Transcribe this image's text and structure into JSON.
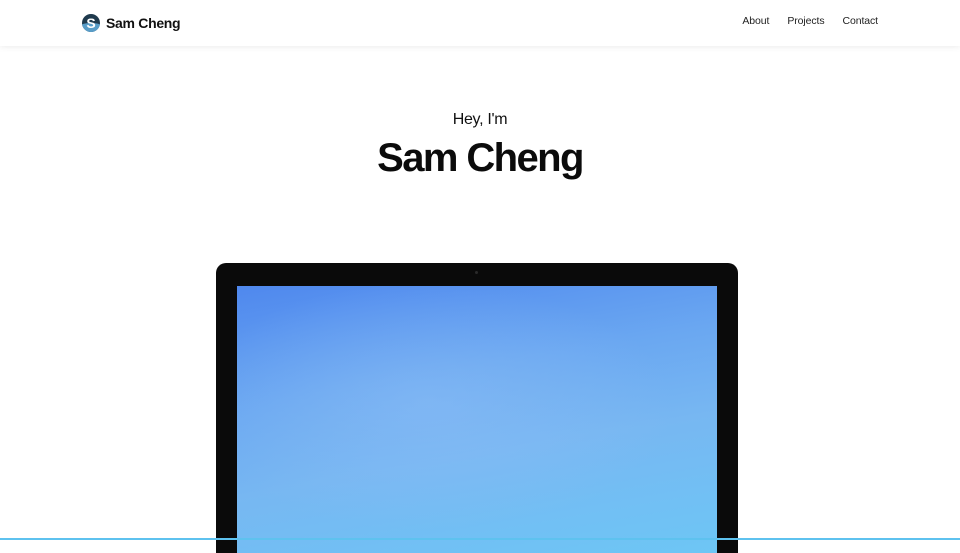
{
  "nav": {
    "brand": {
      "logo_letter": "S",
      "name": "Sam Cheng"
    },
    "links": [
      {
        "label": "About"
      },
      {
        "label": "Projects"
      },
      {
        "label": "Contact"
      }
    ]
  },
  "hero": {
    "greeting": "Hey, I'm",
    "name": "Sam Cheng"
  },
  "colors": {
    "logo_background": "#1f3a4d",
    "screen_gradient_top": "#4f88ee",
    "screen_gradient_bottom": "#6dc6f5",
    "laptop_frame": "#0a0a0a"
  },
  "icons": {
    "logo": "circle-s-logo-icon",
    "camera": "webcam-dot-icon"
  }
}
